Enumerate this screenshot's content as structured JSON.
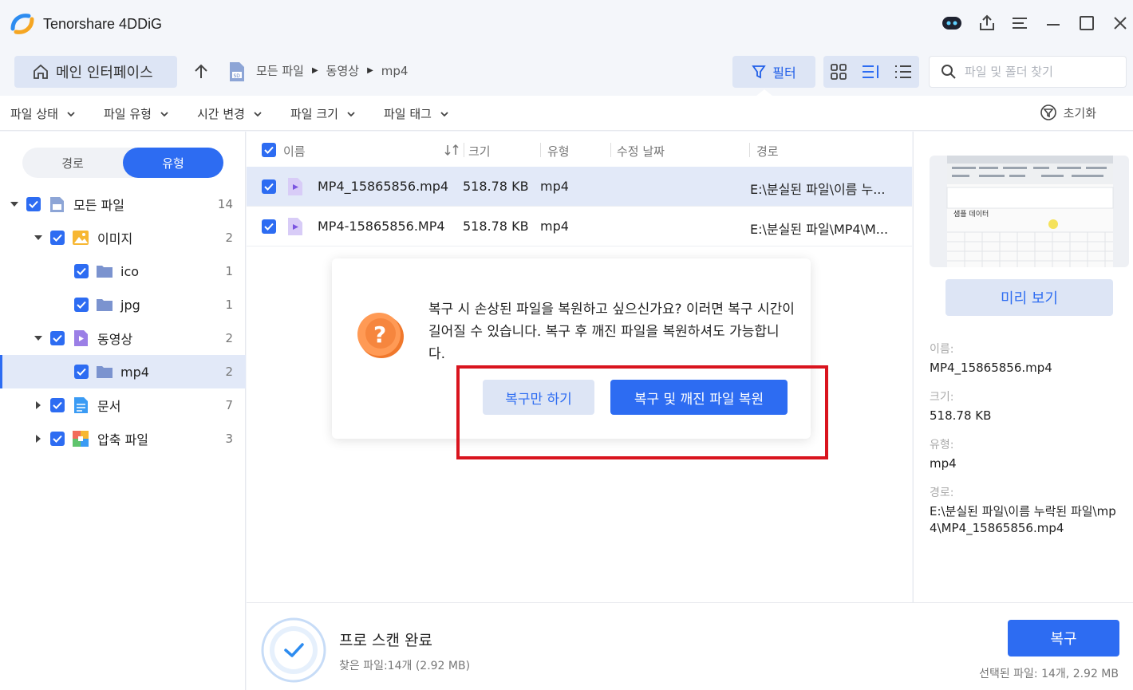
{
  "app": {
    "title": "Tenorshare 4DDiG"
  },
  "nav": {
    "home_label": "메인 인터페이스",
    "breadcrumb": [
      "모든 파일",
      "동영상",
      "mp4"
    ],
    "filter_label": "필터",
    "search_placeholder": "파일 및 폴더 찾기"
  },
  "filters": {
    "items": [
      "파일 상태",
      "파일 유형",
      "시간 변경",
      "파일 크기",
      "파일 태그"
    ],
    "reset_label": "초기화"
  },
  "sidebar": {
    "tab_path": "경로",
    "tab_type": "유형",
    "tree": [
      {
        "label": "모든 파일",
        "count": "14"
      },
      {
        "label": "이미지",
        "count": "2"
      },
      {
        "label": "ico",
        "count": "1"
      },
      {
        "label": "jpg",
        "count": "1"
      },
      {
        "label": "동영상",
        "count": "2"
      },
      {
        "label": "mp4",
        "count": "2"
      },
      {
        "label": "문서",
        "count": "7"
      },
      {
        "label": "압축 파일",
        "count": "3"
      }
    ]
  },
  "table": {
    "headers": {
      "name": "이름",
      "size": "크기",
      "type": "유형",
      "modified": "수정 날짜",
      "path": "경로"
    },
    "rows": [
      {
        "name": "MP4_15865856.mp4",
        "size": "518.78 KB",
        "type": "mp4",
        "path": "E:\\분실된 파일\\이름 누..."
      },
      {
        "name": "MP4-15865856.MP4",
        "size": "518.78 KB",
        "type": "mp4",
        "path": "E:\\분실된 파일\\MP4\\M..."
      }
    ]
  },
  "dialog": {
    "message": "복구 시 손상된 파일을 복원하고 싶으신가요? 이러면 복구 시간이 길어질 수 있습니다. 복구 후 깨진 파일을 복원하셔도 가능합니다.",
    "recover_only": "복구만 하기",
    "recover_and_repair": "복구 및 깨진 파일 복원"
  },
  "preview": {
    "thumb_text": "샘플 데이터",
    "preview_label": "미리 보기",
    "name_label": "이름:",
    "name_value": "MP4_15865856.mp4",
    "size_label": "크기:",
    "size_value": "518.78 KB",
    "type_label": "유형:",
    "type_value": "mp4",
    "path_label": "경로:",
    "path_value": "E:\\분실된 파일\\이름 누락된 파일\\mp4\\MP4_15865856.mp4"
  },
  "bottom": {
    "scan_title": "프로 스캔 완료",
    "scan_sub": "찾은 파일:14개 (2.92 MB)",
    "recover_label": "복구",
    "selected_info": "선택된 파일: 14개, 2.92 MB"
  },
  "colors": {
    "accent": "#2d6cf2",
    "accent_light": "#dde5f5",
    "highlight": "#d9141e"
  }
}
